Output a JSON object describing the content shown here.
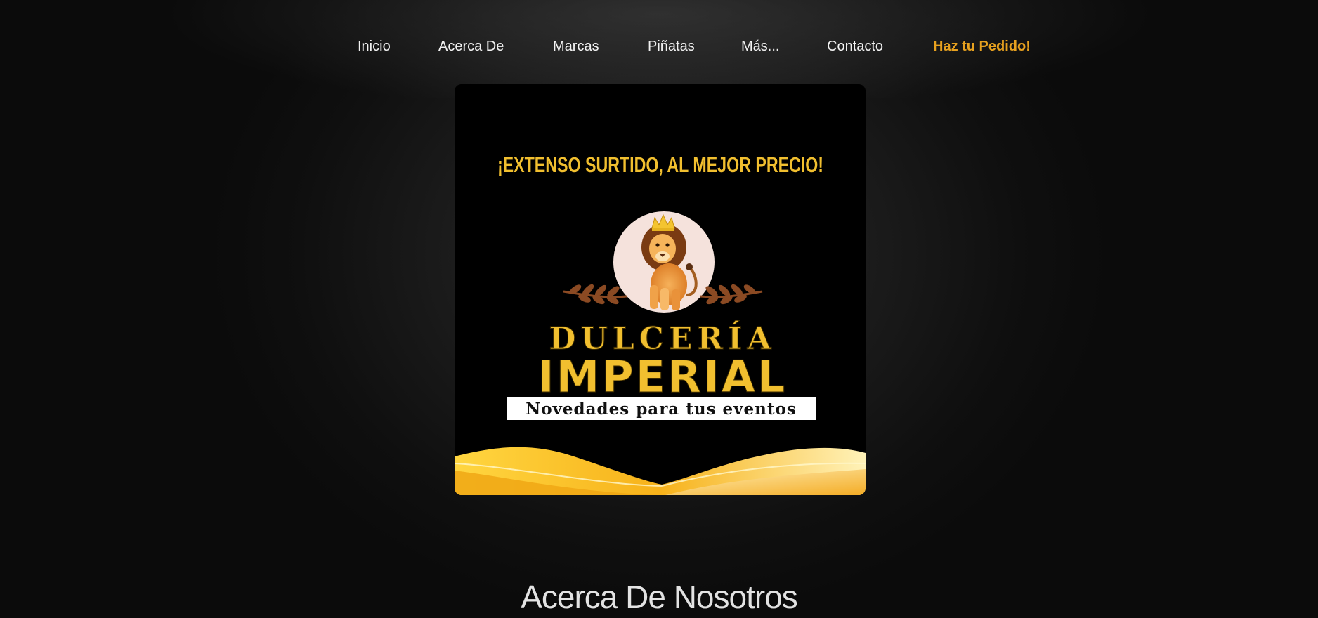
{
  "nav": {
    "items": [
      {
        "label": "Inicio"
      },
      {
        "label": "Acerca De"
      },
      {
        "label": "Marcas"
      },
      {
        "label": "Piñatas"
      },
      {
        "label": "Más..."
      },
      {
        "label": "Contacto"
      }
    ],
    "cta_label": "Haz tu Pedido!",
    "cta_color": "#e7a11f"
  },
  "hero": {
    "tagline": "¡EXTENSO SURTIDO, AL MEJOR PRECIO!",
    "brand_line1": "DULCERÍA",
    "brand_line2": "IMPERIAL",
    "subtitle": "Novedades para tus eventos",
    "logo_icon": "crowned-lion-icon",
    "accent_color": "#f1bf2f"
  },
  "about": {
    "title": "Acerca De Nosotros"
  }
}
